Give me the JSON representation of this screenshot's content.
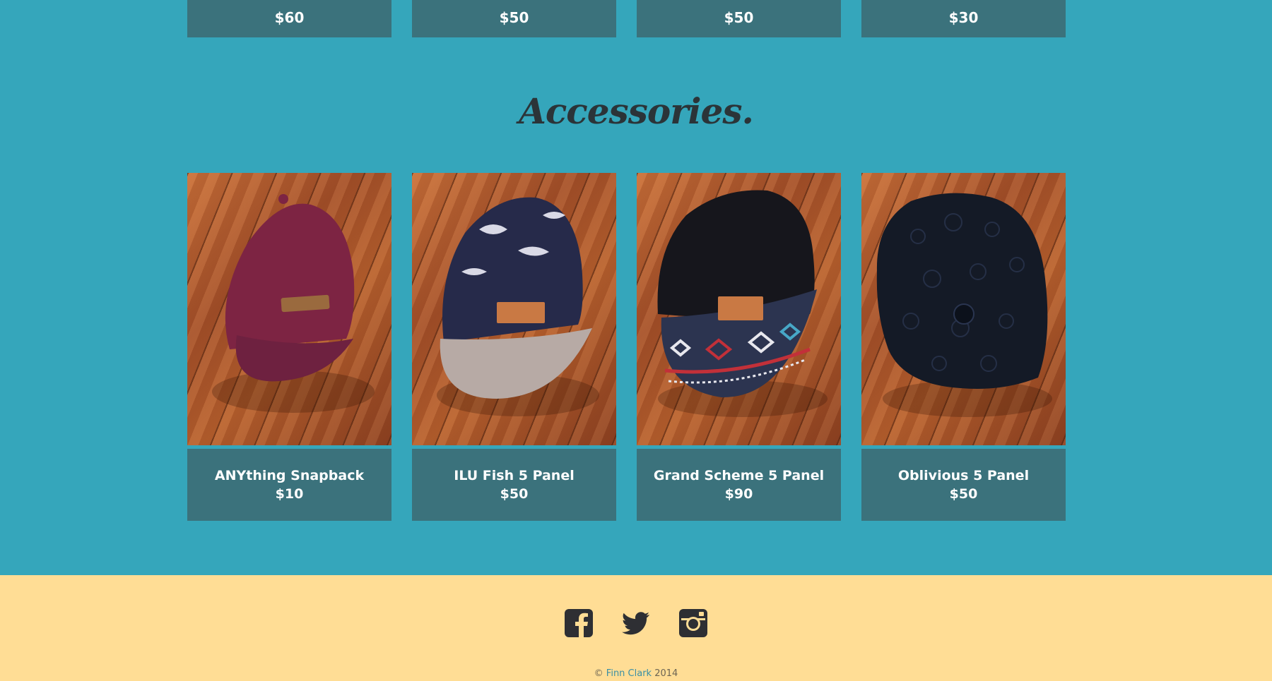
{
  "top_row": {
    "prices": [
      "$60",
      "$50",
      "$50",
      "$30"
    ]
  },
  "section": {
    "title": "Accessories."
  },
  "products": [
    {
      "name": "ANYthing Snapback",
      "price": "$10",
      "cap_color": "#7d2443",
      "brim_color": "#6e2140",
      "label": "ANYthing"
    },
    {
      "name": "ILU Fish 5 Panel",
      "price": "$50",
      "cap_color": "#262a4a",
      "brim_color": "#b7aaa5",
      "label": ""
    },
    {
      "name": "Grand Scheme 5 Panel",
      "price": "$90",
      "cap_color": "#16161c",
      "brim_color": "#2c3450",
      "label": "Grand Scheme"
    },
    {
      "name": "Oblivious 5 Panel",
      "price": "$50",
      "cap_color": "#141a26",
      "brim_color": "#121825",
      "label": ""
    }
  ],
  "footer": {
    "social": [
      "facebook-icon",
      "twitter-icon",
      "instagram-icon"
    ],
    "copyright_symbol": "©",
    "author": "Finn Clark",
    "year": "2014"
  },
  "colors": {
    "background": "#35a6bb",
    "card": "#3b727c",
    "footer": "#ffdd95",
    "title": "#2b3438",
    "link": "#3a8fa5"
  }
}
